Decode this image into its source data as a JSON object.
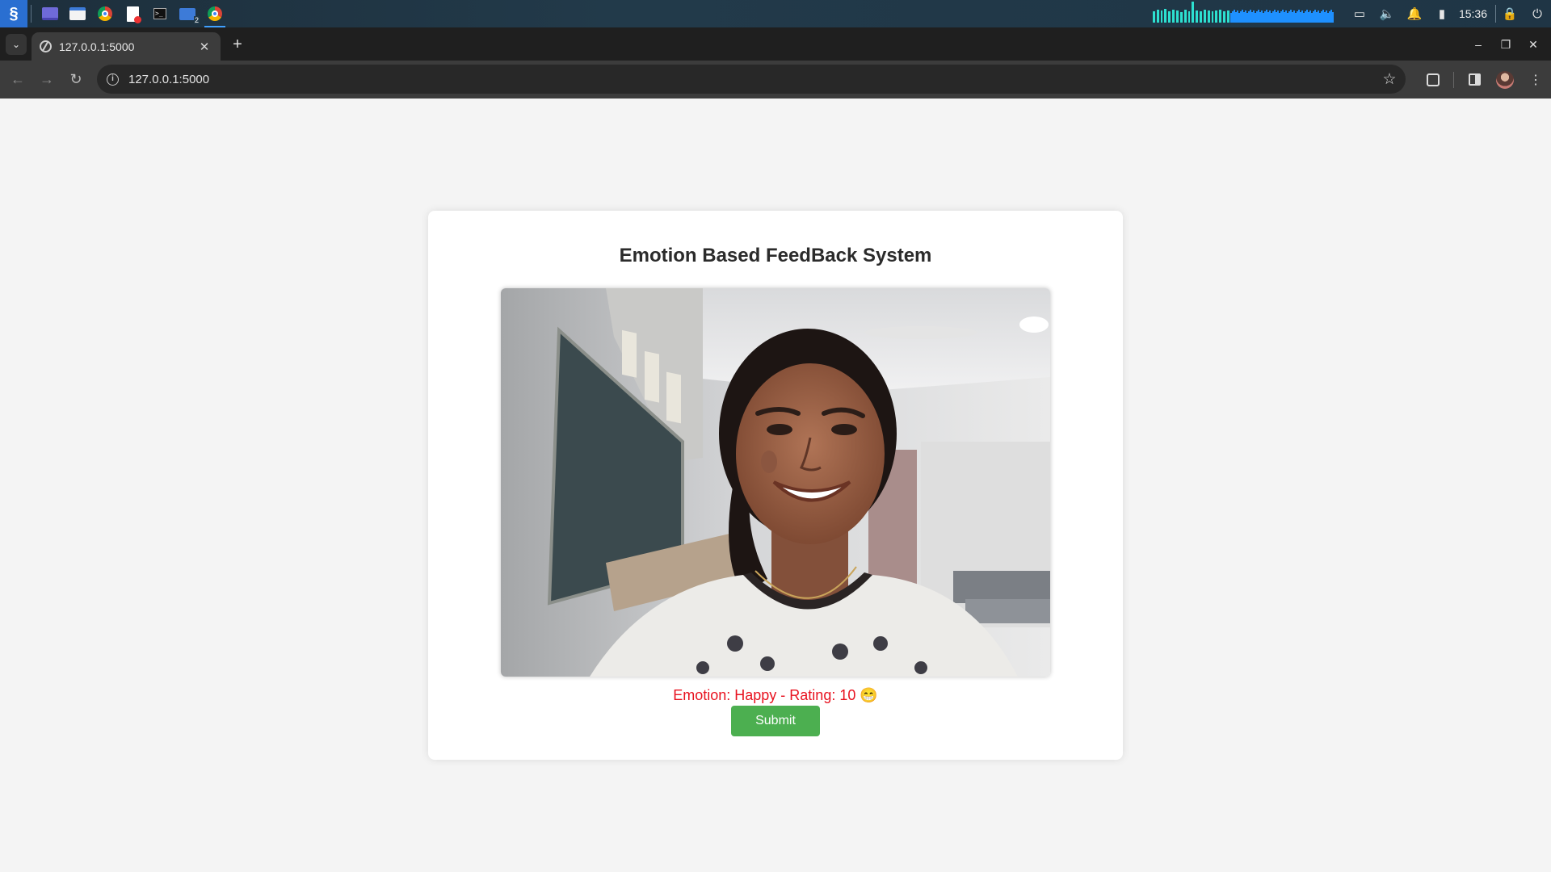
{
  "taskbar": {
    "apps": [
      "start-menu",
      "desktop",
      "file-manager",
      "chrome",
      "pdf-editor",
      "terminal",
      "files-2",
      "chrome-active"
    ],
    "term_glyph": ">_",
    "files_badge": "2",
    "clock": "15:36"
  },
  "browser": {
    "tab_title": "127.0.0.1:5000",
    "url": "127.0.0.1:5000"
  },
  "page": {
    "title": "Emotion Based FeedBack System",
    "emotion_label": "Emotion: Happy - Rating: 10 😁",
    "submit_label": "Submit",
    "colors": {
      "emotion_text": "#e8121f",
      "submit_bg": "#4caf50",
      "card_bg": "#ffffff",
      "page_bg": "#f4f4f4"
    }
  }
}
